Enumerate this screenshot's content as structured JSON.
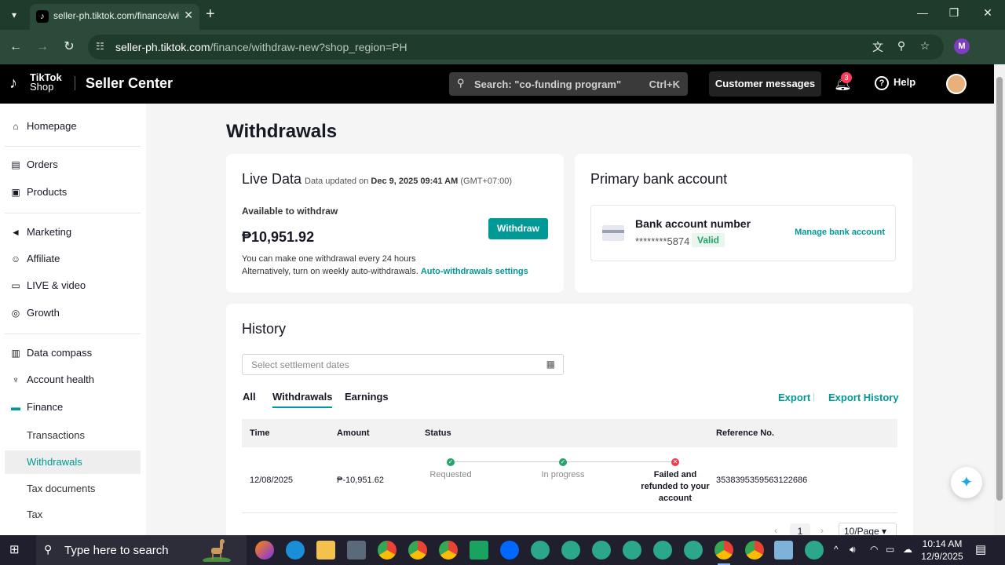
{
  "browser": {
    "tab_title": "seller-ph.tiktok.com/finance/wi",
    "url_host": "seller-ph.tiktok.com",
    "url_path": "/finance/withdraw-new?shop_region=PH",
    "profile_initial": "M"
  },
  "header": {
    "brand_line1": "TikTok",
    "brand_line2": "Shop",
    "product": "Seller Center",
    "search_placeholder": "Search: \"co-funding program\"",
    "search_shortcut": "Ctrl+K",
    "customer_messages": "Customer messages",
    "notification_count": "3",
    "help": "Help"
  },
  "sidebar": {
    "items": [
      {
        "label": "Homepage",
        "icon": "home-icon"
      },
      {
        "label": "Orders",
        "icon": "clipboard-icon"
      },
      {
        "label": "Products",
        "icon": "box-icon"
      },
      {
        "label": "Marketing",
        "icon": "megaphone-icon"
      },
      {
        "label": "Affiliate",
        "icon": "people-icon"
      },
      {
        "label": "LIVE & video",
        "icon": "video-icon"
      },
      {
        "label": "Growth",
        "icon": "medal-icon"
      },
      {
        "label": "Data compass",
        "icon": "chart-icon"
      },
      {
        "label": "Account health",
        "icon": "trophy-icon"
      },
      {
        "label": "Finance",
        "icon": "wallet-icon"
      },
      {
        "label": "Transactions"
      },
      {
        "label": "Withdrawals"
      },
      {
        "label": "Tax documents"
      },
      {
        "label": "Tax"
      }
    ]
  },
  "page": {
    "title": "Withdrawals",
    "live": {
      "title": "Live Data",
      "updated_prefix": "Data updated on ",
      "updated_date": "Dec 9, 2025 09:41 AM",
      "updated_tz": " (GMT+07:00)",
      "available_label": "Available to withdraw",
      "balance": "₱10,951.92",
      "withdraw_button": "Withdraw",
      "note1": "You can make one withdrawal every 24 hours",
      "note2": "Alternatively, turn on weekly auto-withdrawals.",
      "auto_link": "Auto-withdrawals settings"
    },
    "bank": {
      "title": "Primary bank account",
      "label": "Bank account number",
      "number": "********5874",
      "status": "Valid",
      "manage": "Manage bank account"
    },
    "history": {
      "title": "History",
      "date_placeholder": "Select settlement dates",
      "tabs": [
        "All",
        "Withdrawals",
        "Earnings"
      ],
      "active_tab": "Withdrawals",
      "export": "Export",
      "export_history": "Export History",
      "columns": [
        "Time",
        "Amount",
        "Status",
        "Reference No."
      ],
      "rows": [
        {
          "time": "12/08/2025",
          "amount": "₱-10,951.62",
          "steps": [
            "Requested",
            "In progress",
            "Failed and refunded to your account"
          ],
          "reference": "3538395359563122686"
        }
      ],
      "page": "1",
      "page_size": "10/Page"
    }
  },
  "taskbar": {
    "search_placeholder": "Type here to search",
    "time": "10:14 AM",
    "date": "12/9/2025"
  }
}
